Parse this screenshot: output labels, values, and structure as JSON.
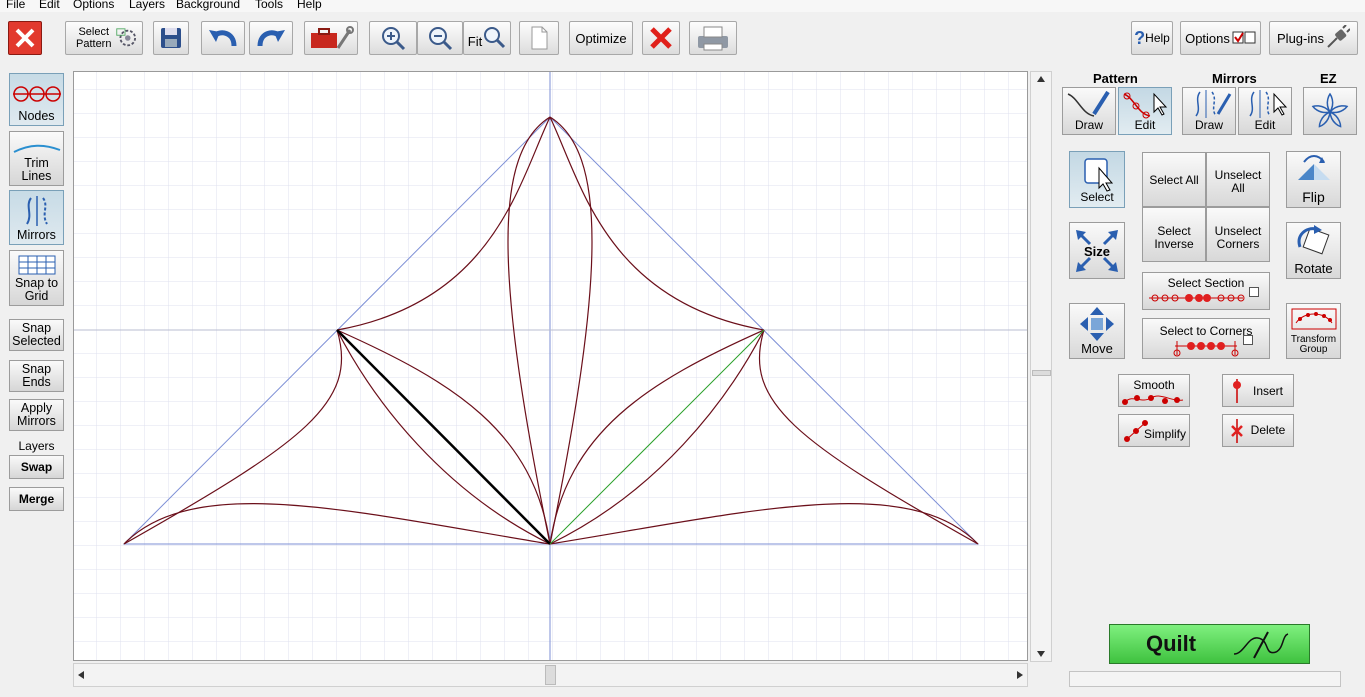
{
  "menu": [
    "File",
    "Edit",
    "Options",
    "Layers",
    "Background",
    "Tools",
    "Help"
  ],
  "toolbar": {
    "select_pattern_line1": "Select",
    "select_pattern_line2": "Pattern",
    "fit_label": "Fit",
    "optimize_label": "Optimize",
    "help_label": "Help",
    "options_label": "Options",
    "plugins_label": "Plug-ins"
  },
  "left_panel": {
    "nodes": "Nodes",
    "trim_line1": "Trim",
    "trim_line2": "Lines",
    "mirrors": "Mirrors",
    "snap_grid_line1": "Snap to",
    "snap_grid_line2": "Grid",
    "snap_sel_line1": "Snap",
    "snap_sel_line2": "Selected",
    "snap_ends_line1": "Snap",
    "snap_ends_line2": "Ends",
    "apply_line1": "Apply",
    "apply_line2": "Mirrors",
    "layers_label": "Layers",
    "swap": "Swap",
    "merge": "Merge"
  },
  "right_panel": {
    "pattern_header": "Pattern",
    "mirrors_header": "Mirrors",
    "ez_header": "EZ",
    "draw": "Draw",
    "edit": "Edit",
    "select": "Select",
    "select_all": "Select All",
    "unselect_all_line1": "Unselect",
    "unselect_all_line2": "All",
    "select_inverse_line1": "Select",
    "select_inverse_line2": "Inverse",
    "unselect_corners_line1": "Unselect",
    "unselect_corners_line2": "Corners",
    "flip": "Flip",
    "size": "Size",
    "rotate": "Rotate",
    "select_section": "Select Section",
    "select_to_corners": "Select to Corners",
    "move": "Move",
    "transform_line1": "Transform",
    "transform_line2": "Group",
    "smooth": "Smooth",
    "insert": "Insert",
    "simplify": "Simplify",
    "delete": "Delete",
    "quilt": "Quilt"
  },
  "colors": {
    "curve": "#6b0f1a",
    "guide": "#7d8fd6",
    "grid": "#dfe1ef",
    "selected_segment": "#000000",
    "green_segment": "#2aa02a",
    "quilt_green": "#5ed85e"
  }
}
